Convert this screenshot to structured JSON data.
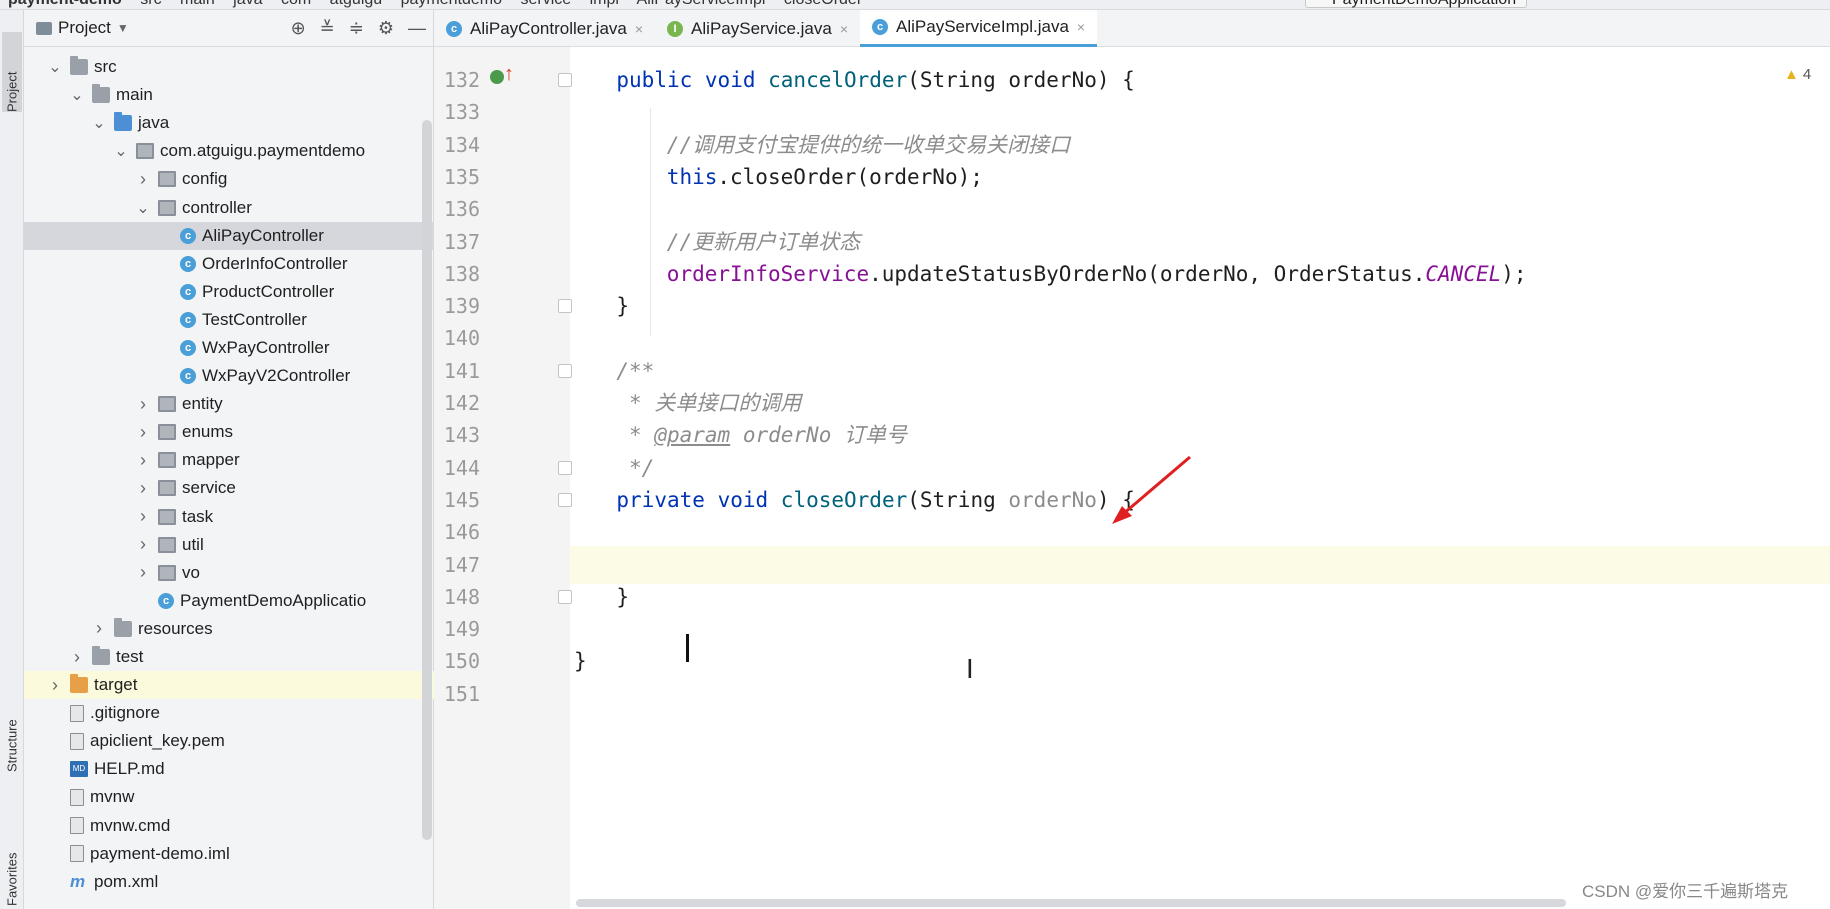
{
  "breadcrumb": [
    "payment-demo",
    "src",
    "main",
    "java",
    "com",
    "atguigu",
    "paymentdemo",
    "service",
    "impl",
    "AliPayServiceImpl",
    "closeOrder"
  ],
  "run_config": "PaymentDemoApplication",
  "toolstrip": {
    "project": "Project",
    "structure": "Structure",
    "favorites": "Favorites"
  },
  "project_panel": {
    "title": "Project",
    "tree": [
      {
        "label": "src",
        "depth": 1,
        "icon": "folder-icon",
        "chevron": "down"
      },
      {
        "label": "main",
        "depth": 2,
        "icon": "folder-icon",
        "chevron": "down"
      },
      {
        "label": "java",
        "depth": 3,
        "icon": "folder-blue-icon",
        "chevron": "down"
      },
      {
        "label": "com.atguigu.paymentdemo",
        "depth": 4,
        "icon": "package-icon",
        "chevron": "down"
      },
      {
        "label": "config",
        "depth": 5,
        "icon": "package-icon",
        "chevron": "right"
      },
      {
        "label": "controller",
        "depth": 5,
        "icon": "package-icon",
        "chevron": "down"
      },
      {
        "label": "AliPayController",
        "depth": 6,
        "icon": "class-icon",
        "selected": true
      },
      {
        "label": "OrderInfoController",
        "depth": 6,
        "icon": "class-icon"
      },
      {
        "label": "ProductController",
        "depth": 6,
        "icon": "class-icon"
      },
      {
        "label": "TestController",
        "depth": 6,
        "icon": "class-icon"
      },
      {
        "label": "WxPayController",
        "depth": 6,
        "icon": "class-icon"
      },
      {
        "label": "WxPayV2Controller",
        "depth": 6,
        "icon": "class-icon"
      },
      {
        "label": "entity",
        "depth": 5,
        "icon": "package-icon",
        "chevron": "right"
      },
      {
        "label": "enums",
        "depth": 5,
        "icon": "package-icon",
        "chevron": "right"
      },
      {
        "label": "mapper",
        "depth": 5,
        "icon": "package-icon",
        "chevron": "right"
      },
      {
        "label": "service",
        "depth": 5,
        "icon": "package-icon",
        "chevron": "right"
      },
      {
        "label": "task",
        "depth": 5,
        "icon": "package-icon",
        "chevron": "right"
      },
      {
        "label": "util",
        "depth": 5,
        "icon": "package-icon",
        "chevron": "right"
      },
      {
        "label": "vo",
        "depth": 5,
        "icon": "package-icon",
        "chevron": "right"
      },
      {
        "label": "PaymentDemoApplicatio",
        "depth": 5,
        "icon": "class-icon"
      },
      {
        "label": "resources",
        "depth": 3,
        "icon": "folder-icon",
        "chevron": "right"
      },
      {
        "label": "test",
        "depth": 2,
        "icon": "folder-icon",
        "chevron": "right"
      },
      {
        "label": "target",
        "depth": 1,
        "icon": "folder-orange-icon",
        "chevron": "right",
        "highlight": true
      },
      {
        "label": ".gitignore",
        "depth": 1,
        "icon": "file-icon"
      },
      {
        "label": "apiclient_key.pem",
        "depth": 1,
        "icon": "file-icon"
      },
      {
        "label": "HELP.md",
        "depth": 1,
        "icon": "markdown-icon"
      },
      {
        "label": "mvnw",
        "depth": 1,
        "icon": "file-icon"
      },
      {
        "label": "mvnw.cmd",
        "depth": 1,
        "icon": "file-icon"
      },
      {
        "label": "payment-demo.iml",
        "depth": 1,
        "icon": "file-icon"
      },
      {
        "label": "pom.xml",
        "depth": 1,
        "icon": "maven-icon"
      }
    ]
  },
  "editor_tabs": [
    {
      "label": "AliPayController.java",
      "icon": "C",
      "active": false
    },
    {
      "label": "AliPayService.java",
      "icon": "I",
      "active": false
    },
    {
      "label": "AliPayServiceImpl.java",
      "icon": "C",
      "active": true
    }
  ],
  "warnings_count": "4",
  "code_lines": [
    {
      "n": "132"
    },
    {
      "n": "133"
    },
    {
      "n": "134"
    },
    {
      "n": "135"
    },
    {
      "n": "136"
    },
    {
      "n": "137"
    },
    {
      "n": "138"
    },
    {
      "n": "139"
    },
    {
      "n": "140"
    },
    {
      "n": "141"
    },
    {
      "n": "142"
    },
    {
      "n": "143"
    },
    {
      "n": "144"
    },
    {
      "n": "145"
    },
    {
      "n": "146"
    },
    {
      "n": "147"
    },
    {
      "n": "148"
    },
    {
      "n": "149"
    },
    {
      "n": "150"
    },
    {
      "n": "151"
    }
  ],
  "code": {
    "l132": [
      "public",
      " ",
      "void",
      " ",
      "cancelOrder",
      "(String orderNo) {"
    ],
    "l134": "//调用支付宝提供的统一收单交易关闭接口",
    "l135": [
      "this",
      ".closeOrder(orderNo);"
    ],
    "l137": "//更新用户订单状态",
    "l138": [
      "orderInfoService",
      ".updateStatusByOrderNo(orderNo, OrderStatus.",
      "CANCEL",
      ");"
    ],
    "l139": "}",
    "l141": "/**",
    "l142": " * 关单接口的调用",
    "l143": [
      " * ",
      "@param",
      " orderNo 订单号"
    ],
    "l144": " */",
    "l145": [
      "private",
      " ",
      "void",
      " ",
      "closeOrder",
      "(String ",
      "orderNo",
      ") {"
    ],
    "l148": "}",
    "l150": "}"
  },
  "watermark": "CSDN @爱你三千遍斯塔克"
}
